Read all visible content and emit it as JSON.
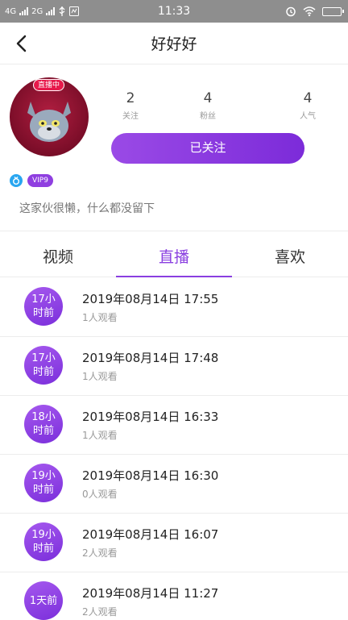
{
  "status_bar": {
    "net1": "4G",
    "net2": "2G",
    "time": "11:33"
  },
  "nav": {
    "title": "好好好"
  },
  "profile": {
    "live_badge": "直播中",
    "stats": [
      {
        "value": "2",
        "label": "关注"
      },
      {
        "value": "4",
        "label": "粉丝"
      },
      {
        "value": "4",
        "label": "人气"
      }
    ],
    "follow_button": "已关注",
    "vip": "VIP9",
    "bio": "这家伙很懒，什么都没留下"
  },
  "tabs": [
    {
      "label": "视频",
      "active": false
    },
    {
      "label": "直播",
      "active": true
    },
    {
      "label": "喜欢",
      "active": false
    }
  ],
  "colors": {
    "accent": "#8a3fe0",
    "live_red": "#e7194b"
  },
  "live_list": [
    {
      "ago": "17小时前",
      "time": "2019年08月14日 17:55",
      "viewers": "1人观看"
    },
    {
      "ago": "17小时前",
      "time": "2019年08月14日 17:48",
      "viewers": "1人观看"
    },
    {
      "ago": "18小时前",
      "time": "2019年08月14日 16:33",
      "viewers": "1人观看"
    },
    {
      "ago": "19小时前",
      "time": "2019年08月14日 16:30",
      "viewers": "0人观看"
    },
    {
      "ago": "19小时前",
      "time": "2019年08月14日 16:07",
      "viewers": "2人观看"
    },
    {
      "ago": "1天前",
      "time": "2019年08月14日 11:27",
      "viewers": "2人观看"
    }
  ]
}
